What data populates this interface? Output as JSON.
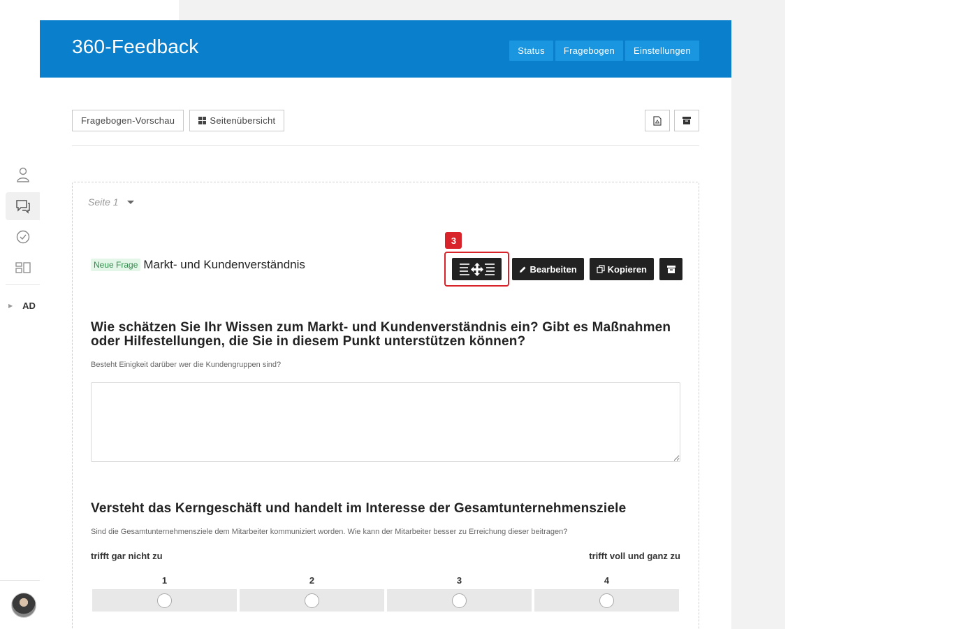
{
  "app": {
    "title": "360-Feedback",
    "nav": [
      "Status",
      "Fragebogen",
      "Einstellungen"
    ]
  },
  "sidebar": {
    "items": [
      {
        "icon": "user-icon"
      },
      {
        "icon": "chat-icon",
        "active": true
      },
      {
        "icon": "check-circle-icon"
      },
      {
        "icon": "dashboard-icon"
      }
    ],
    "section_label": "AD"
  },
  "toolbar": {
    "preview_label": "Fragebogen-Vorschau",
    "overview_label": "Seitenübersicht",
    "pdf_icon": "pdf-icon",
    "archive_icon": "archive-icon"
  },
  "page": {
    "label": "Seite 1"
  },
  "question_block": {
    "badge": "Neue Frage",
    "title": "Markt- und Kundenverständnis",
    "marker": "3",
    "edit_label": "Bearbeiten",
    "copy_label": "Kopieren"
  },
  "question1": {
    "title": "Wie schätzen Sie Ihr Wissen zum Markt- und Kundenverständnis ein? Gibt es Maßnahmen oder Hilfestellungen, die Sie in diesem Punkt unterstützen können?",
    "hint": "Besteht Einigkeit darüber wer die Kundengruppen sind?"
  },
  "question2": {
    "title": "Versteht das Kerngeschäft und handelt im Interesse der Gesamtunternehmensziele",
    "hint": "Sind die Gesamtunternehmensziele dem Mitarbeiter kommuniziert worden. Wie kann der Mitarbeiter besser zu Erreichung dieser beitragen?",
    "scale_low": "trifft gar nicht zu",
    "scale_high": "trifft voll und ganz zu",
    "scale": [
      "1",
      "2",
      "3",
      "4"
    ]
  },
  "colors": {
    "header": "#0a7fcc",
    "nav_button": "#1a96e0",
    "dark_button": "#222222",
    "highlight": "#d9232a",
    "badge_bg": "#e3f6e8"
  }
}
